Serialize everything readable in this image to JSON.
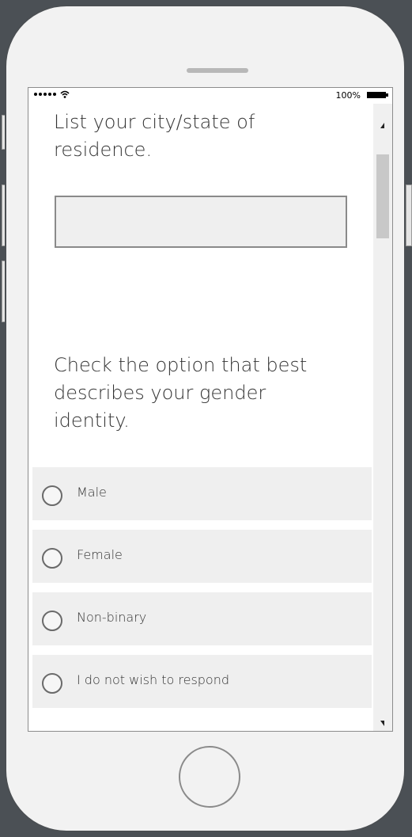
{
  "status_bar": {
    "signal_dots": 5,
    "battery_percent": "100%",
    "battery_level": 1.0
  },
  "form": {
    "question_city": "List your city/state of residence.",
    "city_input_value": "",
    "question_gender": "Check the option that best describes your gender identity.",
    "gender_options": [
      {
        "label": "Male",
        "selected": false
      },
      {
        "label": "Female",
        "selected": false
      },
      {
        "label": "Non-binary",
        "selected": false
      },
      {
        "label": "I do not wish to respond",
        "selected": false
      }
    ]
  },
  "colors": {
    "phone_body": "#f2f2f2",
    "background": "#4b5055",
    "option_bg": "#efefef",
    "text": "#333333"
  }
}
